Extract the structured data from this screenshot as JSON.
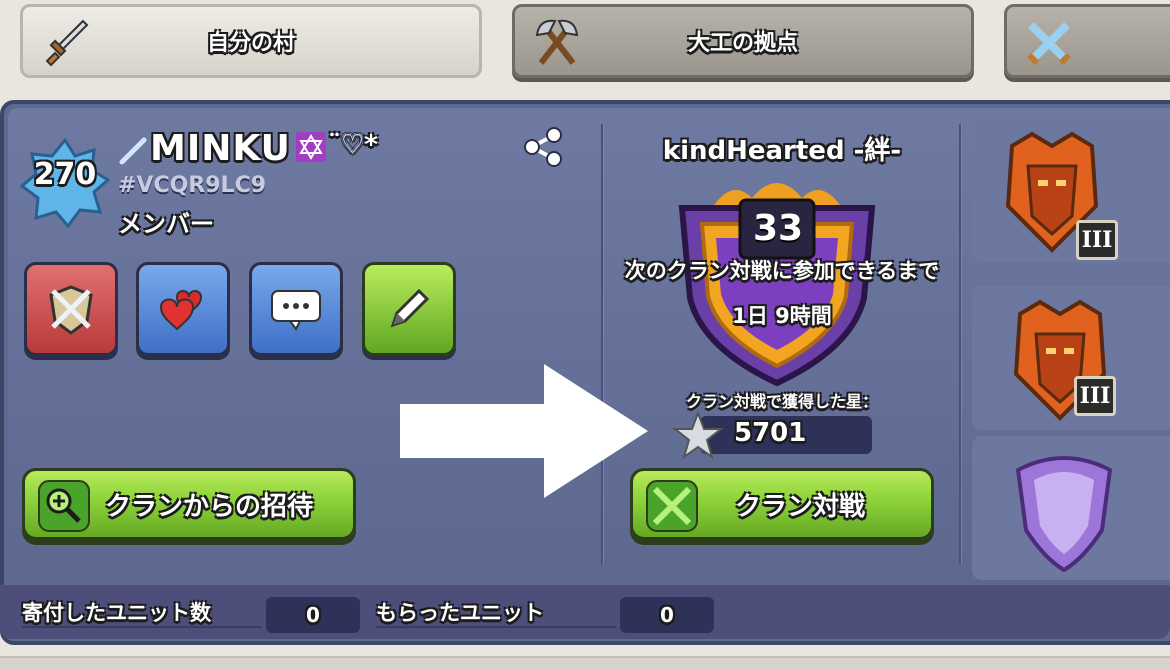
{
  "tabs": [
    {
      "label": "自分の村",
      "icon": "sword-icon",
      "active": true
    },
    {
      "label": "大工の拠点",
      "icon": "crossed-axes-icon",
      "active": false
    },
    {
      "label": "",
      "icon": "crossed-swords-icon",
      "active": false
    }
  ],
  "player": {
    "level": "270",
    "name": "MINKU",
    "name_deco": "¨♡*",
    "tag": "#VCQR9LC9",
    "role": "メンバー"
  },
  "actions": {
    "clan_invite_label": "クランからの招待"
  },
  "clan": {
    "name": "kindHearted -絆-",
    "level": "33",
    "war_wait_text": "次のクラン対戦に参加できるまで",
    "war_wait_time": "1日 9時間",
    "stars_label": "クラン対戦で獲得した星：",
    "stars_value": "5701",
    "war_button_label": "クラン対戦"
  },
  "leagues": [
    {
      "icon": "dragon-league-icon",
      "rank": "III"
    },
    {
      "icon": "dragon-league-icon",
      "rank": "III"
    },
    {
      "icon": "crystal-shield-icon",
      "rank": ""
    }
  ],
  "stats": {
    "donated_label": "寄付したユニット数",
    "donated_value": "0",
    "received_label": "もらったユニット",
    "received_value": "0"
  },
  "colors": {
    "panel": "#6e7aa2",
    "green_button": "#8cd23a",
    "stat_box": "#2e3258"
  }
}
